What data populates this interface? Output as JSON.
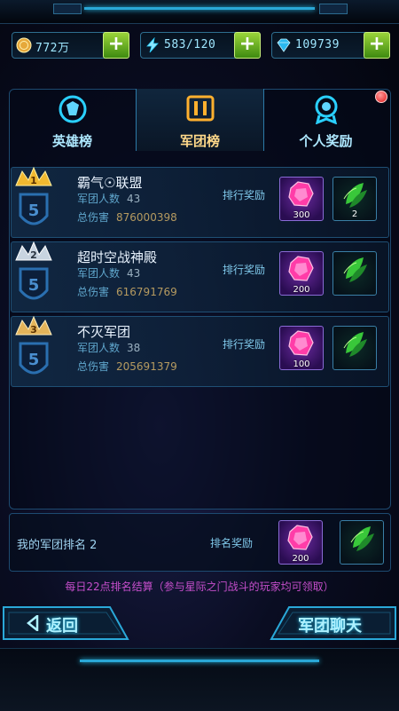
{
  "resources": [
    {
      "icon": "gold-coin-icon",
      "value": "772万"
    },
    {
      "icon": "energy-lightning-icon",
      "value": "583/120"
    },
    {
      "icon": "diamond-icon",
      "value": "109739"
    }
  ],
  "tabs": [
    {
      "label": "英雄榜",
      "icon": "hero-badge-icon",
      "active": false
    },
    {
      "label": "军团榜",
      "icon": "legion-banner-icon",
      "active": true
    },
    {
      "label": "个人奖励",
      "icon": "personal-reward-icon",
      "active": false
    }
  ],
  "stat_labels": {
    "members": "军团人数",
    "damage": "总伤害",
    "reward": "排行奖励"
  },
  "rankings": [
    {
      "rank": "1",
      "name": "霸气☉联盟",
      "members": "43",
      "damage": "876000398",
      "gem_count": "300",
      "leaf_count": "2"
    },
    {
      "rank": "2",
      "name": "超时空战神殿",
      "members": "43",
      "damage": "616791769",
      "gem_count": "200",
      "leaf_count": ""
    },
    {
      "rank": "3",
      "name": "不灭军团",
      "members": "38",
      "damage": "205691379",
      "gem_count": "100",
      "leaf_count": ""
    }
  ],
  "badge_level": "5",
  "my_rank": {
    "label": "我的军团排名",
    "value": "2",
    "reward_label": "排名奖励",
    "gem_count": "200"
  },
  "notice": "每日22点排名结算（参与星际之门战斗的玩家均可领取）",
  "buttons": {
    "back": "返回",
    "chat": "军团聊天"
  },
  "colors": {
    "accent": "#2ad0ff",
    "gold": "#f0b830",
    "silver": "#c8d4e0",
    "notice": "#c54ecb",
    "gem": "#ff3ca8",
    "leaf": "#39c83a"
  }
}
